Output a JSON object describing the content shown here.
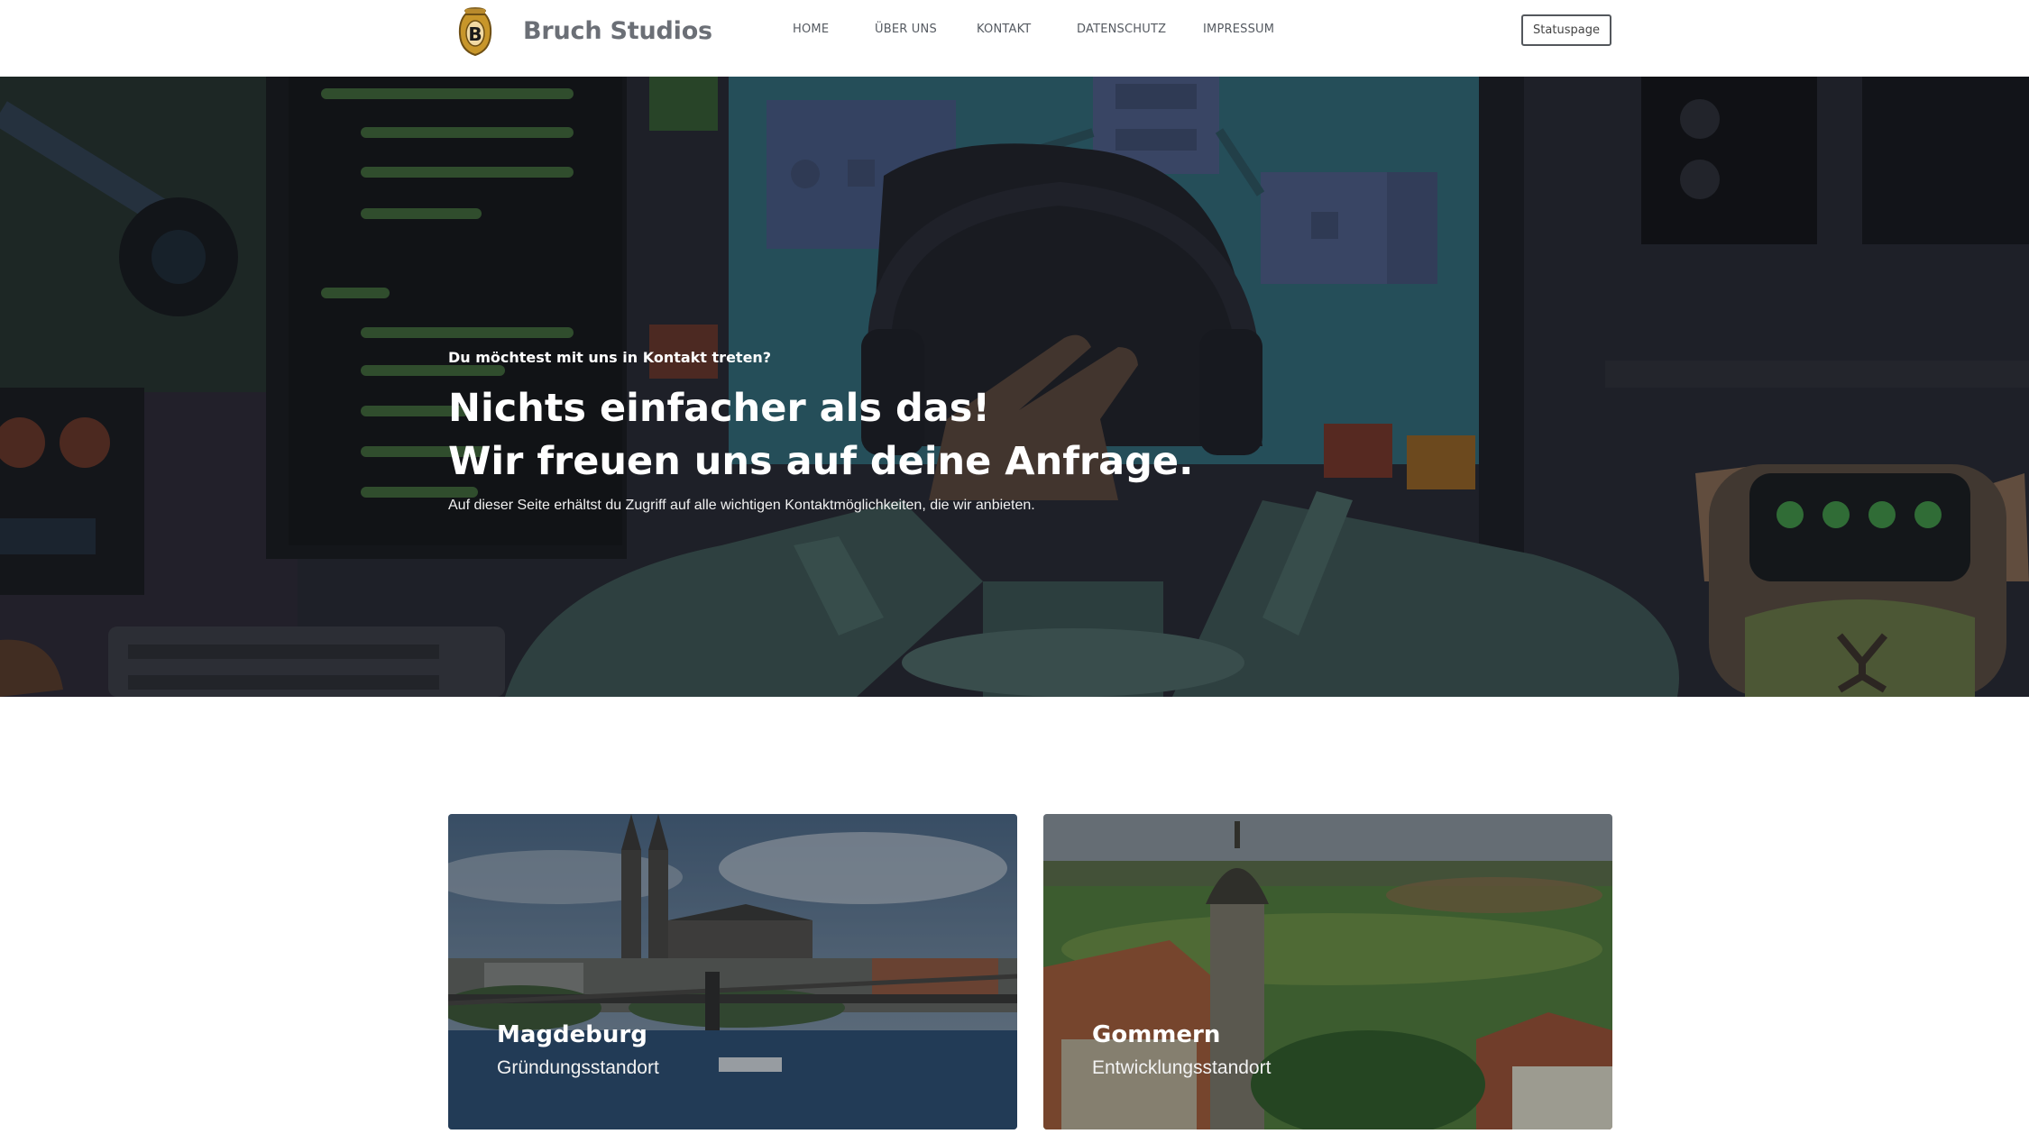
{
  "header": {
    "brand_name": "Bruch Studios",
    "logo_letter": "B",
    "nav": [
      {
        "label": "Home"
      },
      {
        "label": "Über uns"
      },
      {
        "label": "Kontakt"
      },
      {
        "label": "Datenschutz"
      },
      {
        "label": "Impressum"
      }
    ],
    "status_button": "Statuspage"
  },
  "hero": {
    "kicker": "Du möchtest mit uns in Kontakt treten?",
    "title_line1": "Nichts einfacher als das!",
    "title_line2": "Wir freuen uns auf deine Anfrage.",
    "subtitle": "Auf dieser Seite erhältst du Zugriff auf alle wichtigen Kontaktmöglichkeiten, die wir anbieten."
  },
  "locations": [
    {
      "city": "Magdeburg",
      "role": "Gründungsstandort"
    },
    {
      "city": "Gommern",
      "role": "Entwicklungsstandort"
    }
  ],
  "colors": {
    "brand_text": "#6b6f76",
    "nav_text": "#555a61",
    "hero_overlay": "#1c1e25",
    "logo_gold": "#c8962a"
  }
}
